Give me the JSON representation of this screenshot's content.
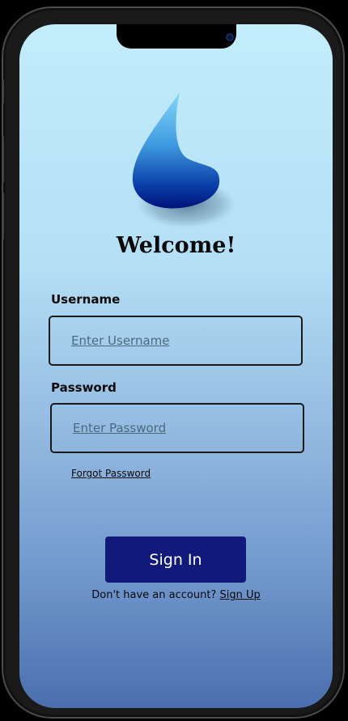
{
  "app": {
    "welcome_title": "Welcome!"
  },
  "login": {
    "username_label": "Username",
    "username_placeholder": "Enter Username",
    "username_value": "",
    "password_label": "Password",
    "password_placeholder": "Enter Password",
    "password_value": "",
    "forgot_label": "Forgot Password",
    "signin_label": "Sign In",
    "signup_prompt": "Don't have an account?",
    "signup_link": "Sign Up"
  },
  "icons": {
    "logo": "water-drop-icon",
    "camera": "camera-icon"
  },
  "colors": {
    "primary_button": "#111a7a",
    "gradient_top": "#c3edfb",
    "gradient_bottom": "#4b6fae",
    "logo_light": "#7fd4f5",
    "logo_dark": "#00147a"
  }
}
